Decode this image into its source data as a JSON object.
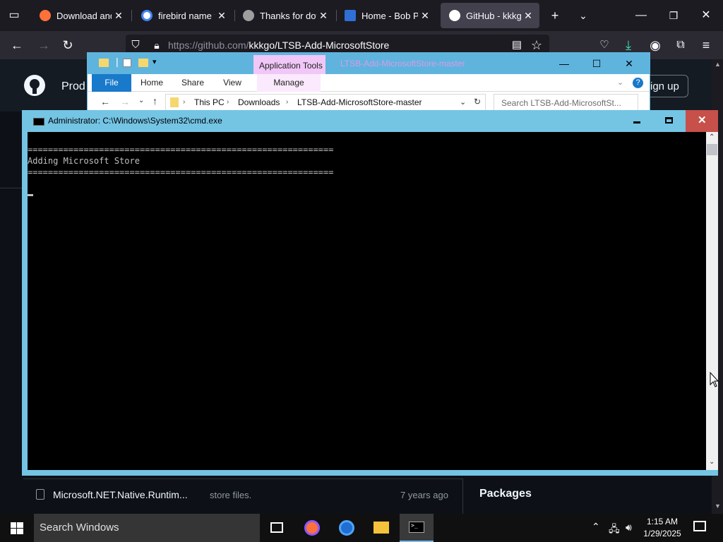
{
  "browser": {
    "tabs": [
      {
        "title": "Download and t",
        "favicon_color": "#ff7139"
      },
      {
        "title": "firebird name fin",
        "favicon_color": "#ffffff"
      },
      {
        "title": "Thanks for down",
        "favicon_color": "#9e9e9e"
      },
      {
        "title": "Home - Bob Por",
        "favicon_color": "#2f6fd6"
      },
      {
        "title": "GitHub - kkkgo/",
        "favicon_color": "#ffffff"
      }
    ],
    "url_host": "https://github.com/",
    "url_path": "kkkgo/LTSB-Add-MicrosoftStore"
  },
  "github": {
    "nav_partial": "Prod",
    "signup_label": "ign up",
    "file_row": {
      "name": "Microsoft.NET.Native.Runtim...",
      "message": "store files.",
      "age": "7 years ago"
    },
    "packages_label": "Packages"
  },
  "explorer": {
    "app_tools": "Application Tools",
    "title": "LTSB-Add-MicrosoftStore-master",
    "ribbon_tabs": [
      "File",
      "Home",
      "Share",
      "View",
      "Manage"
    ],
    "breadcrumb": [
      "This PC",
      "Downloads",
      "LTSB-Add-MicrosoftStore-master"
    ],
    "search_placeholder": "Search LTSB-Add-MicrosoftSt..."
  },
  "cmd": {
    "title": "Administrator: C:\\Windows\\System32\\cmd.exe",
    "lines": [
      "============================================================",
      "Adding Microsoft Store",
      "============================================================"
    ]
  },
  "taskbar": {
    "search_placeholder": "Search Windows",
    "time": "1:15 AM",
    "date": "1/29/2025"
  },
  "colors": {
    "cmd_frame": "#74c4e4",
    "close_red": "#c7504a",
    "explorer_frame": "#5fb4de"
  }
}
